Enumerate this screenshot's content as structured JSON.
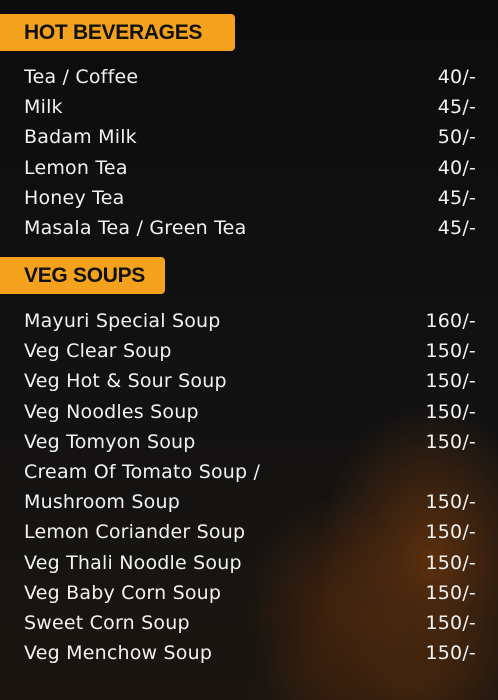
{
  "hot_beverages": {
    "title": "HOT BEVERAGES",
    "items": [
      {
        "name": "Tea / Coffee",
        "price": "40/-"
      },
      {
        "name": "Milk",
        "price": "45/-"
      },
      {
        "name": "Badam Milk",
        "price": "50/-"
      },
      {
        "name": "Lemon Tea",
        "price": "40/-"
      },
      {
        "name": "Honey Tea",
        "price": "45/-"
      },
      {
        "name": "Masala Tea / Green Tea",
        "price": "45/-"
      }
    ]
  },
  "veg_soups": {
    "title": "VEG SOUPS",
    "items": [
      {
        "name": "Mayuri Special Soup",
        "price": "160/-"
      },
      {
        "name": "Veg Clear Soup",
        "price": "150/-"
      },
      {
        "name": "Veg Hot & Sour Soup",
        "price": "150/-"
      },
      {
        "name": "Veg Noodles Soup",
        "price": "150/-"
      },
      {
        "name": "Veg Tomyon Soup",
        "price": "150/-"
      },
      {
        "name": "Cream Of Tomato Soup /",
        "price": ""
      },
      {
        "name": "Mushroom Soup",
        "price": "150/-"
      },
      {
        "name": "Lemon Coriander Soup",
        "price": "150/-"
      },
      {
        "name": "Veg Thali Noodle Soup",
        "price": "150/-"
      },
      {
        "name": "Veg Baby Corn Soup",
        "price": "150/-"
      },
      {
        "name": "Sweet Corn Soup",
        "price": "150/-"
      },
      {
        "name": "Veg Menchow Soup",
        "price": "150/-"
      }
    ]
  },
  "colors": {
    "header_bg": "#f4a11d",
    "header_text": "#111111",
    "text": "#f2f2f2",
    "background": "#0b0b0b"
  }
}
